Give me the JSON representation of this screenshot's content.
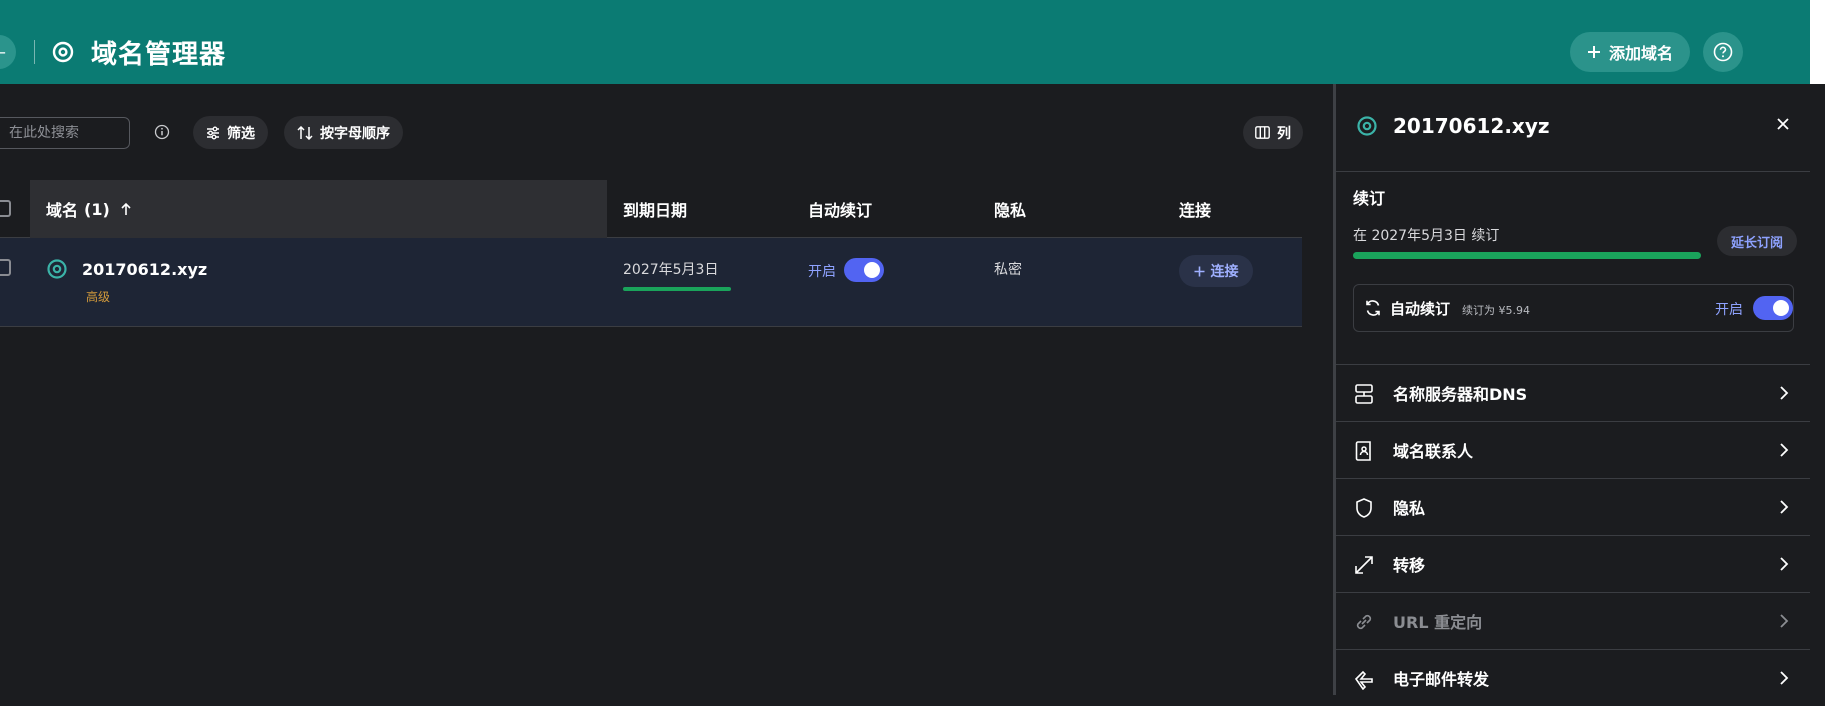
{
  "header": {
    "title": "域名管理器",
    "add_domain_label": "添加域名",
    "back_label": "←"
  },
  "toolbar": {
    "search_placeholder": "在此处搜索",
    "filter_label": "筛选",
    "sort_label": "按字母顺序",
    "columns_label": "列"
  },
  "table": {
    "headers": {
      "domain": "域名",
      "domain_count": "(1)",
      "expiry": "到期日期",
      "auto_renew": "自动续订",
      "privacy": "隐私",
      "connect": "连接"
    },
    "rows": [
      {
        "domain": "20170612.xyz",
        "tier": "高级",
        "expiry": "2027年5月3日",
        "expiry_remaining_fraction": 1.0,
        "auto_renew_label": "开启",
        "auto_renew_on": true,
        "privacy": "私密",
        "connect_label": "连接"
      }
    ]
  },
  "panel": {
    "title": "20170612.xyz",
    "renewal_section_title": "续订",
    "renew_on_text": "在 2027年5月3日 续订",
    "renew_progress_fraction": 1.0,
    "extend_label": "延长订阅",
    "auto_renew_title": "自动续订",
    "auto_renew_price": "续订为 ¥5.94",
    "auto_renew_state_label": "开启",
    "nav_items": [
      {
        "label": "名称服务器和DNS",
        "icon": "server-icon",
        "enabled": true
      },
      {
        "label": "域名联系人",
        "icon": "contact-book-icon",
        "enabled": true
      },
      {
        "label": "隐私",
        "icon": "shield-icon",
        "enabled": true
      },
      {
        "label": "转移",
        "icon": "transfer-icon",
        "enabled": true
      },
      {
        "label": "URL 重定向",
        "icon": "link-icon",
        "enabled": false
      },
      {
        "label": "电子邮件转发",
        "icon": "email-forward-icon",
        "enabled": true
      }
    ]
  },
  "colors": {
    "header_bg": "#0b7b73",
    "accent": "#5264f2",
    "progress": "#1aa35b",
    "tier": "#d39a3b",
    "row_selected": "#1e2535"
  }
}
